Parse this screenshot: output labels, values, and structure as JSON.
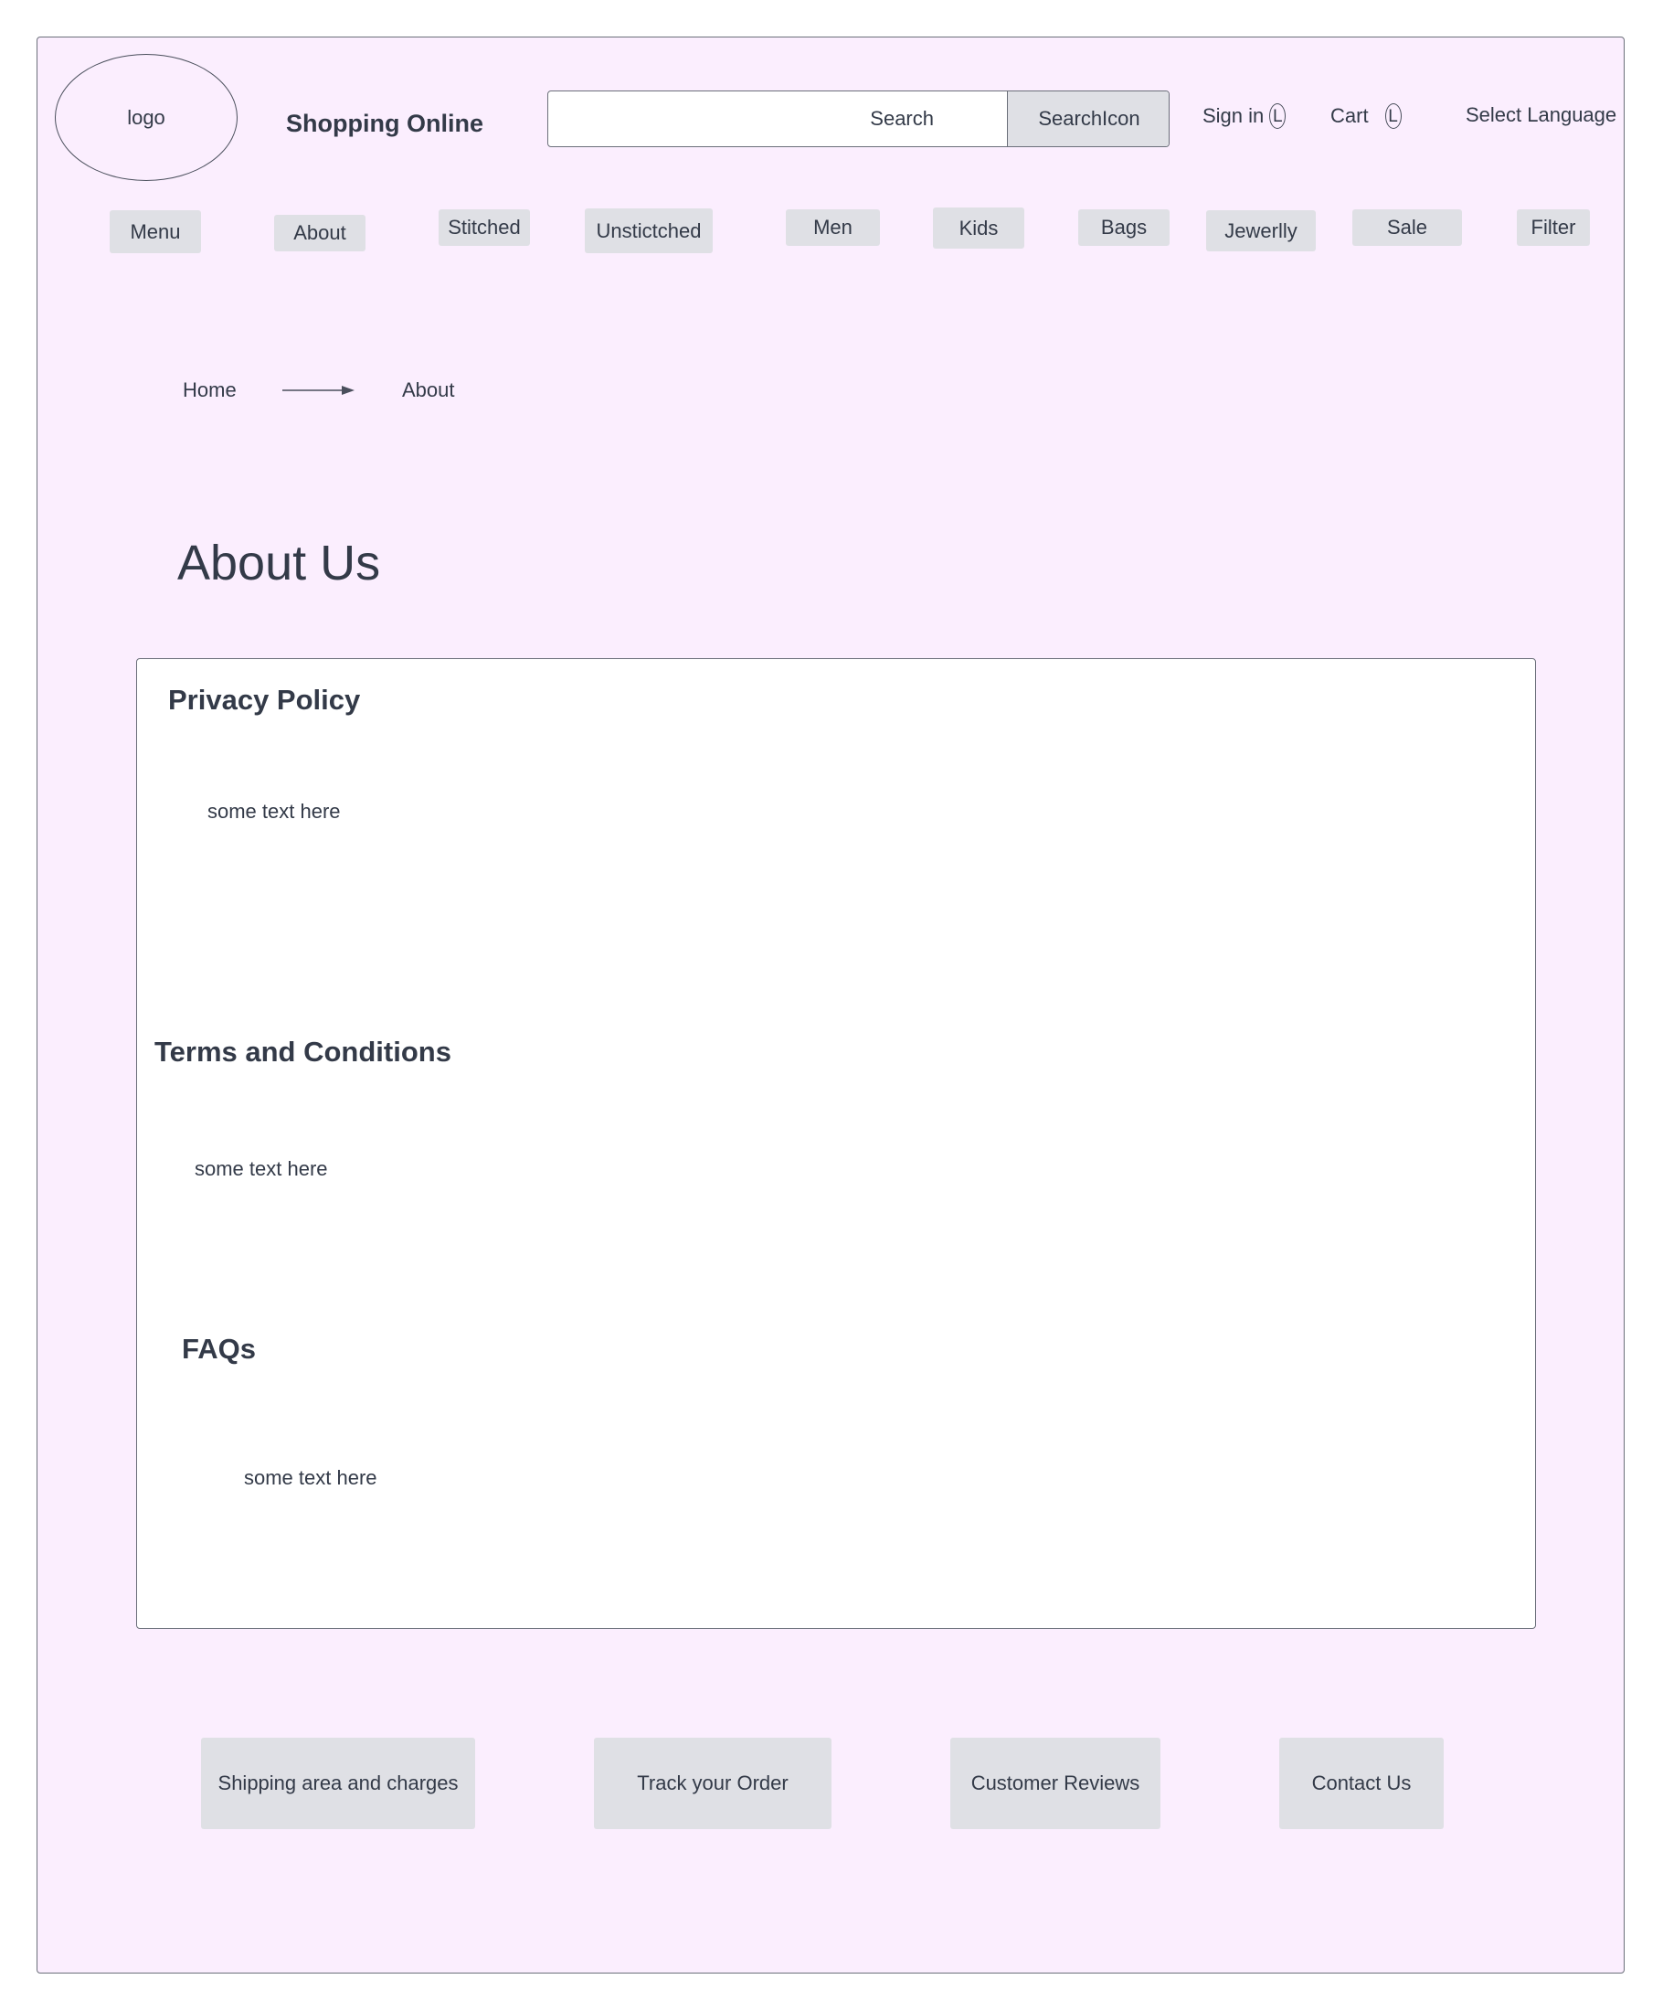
{
  "header": {
    "logo_text": "logo",
    "site_title": "Shopping Online",
    "search": {
      "placeholder": "Search",
      "button_label": "SearchIcon"
    },
    "sign_in": {
      "label": "Sign in",
      "icon": "L"
    },
    "cart": {
      "label": "Cart",
      "icon": "L"
    },
    "language": "Select Language"
  },
  "nav": {
    "items": [
      {
        "label": "Menu"
      },
      {
        "label": "About"
      },
      {
        "label": "Stitched"
      },
      {
        "label": "Unstictched"
      },
      {
        "label": "Men"
      },
      {
        "label": "Kids"
      },
      {
        "label": "Bags"
      },
      {
        "label": "Jewerlly"
      },
      {
        "label": "Sale"
      },
      {
        "label": "Filter"
      }
    ]
  },
  "breadcrumb": {
    "home": "Home",
    "current": "About"
  },
  "page_title": "About Us",
  "sections": [
    {
      "title": "Privacy Policy",
      "text": "some text here"
    },
    {
      "title": "Terms and Conditions",
      "text": "some text here"
    },
    {
      "title": "FAQs",
      "text": "some text here"
    }
  ],
  "footer": {
    "buttons": [
      {
        "label": "Shipping area and charges"
      },
      {
        "label": "Track your Order"
      },
      {
        "label": "Customer Reviews"
      },
      {
        "label": "Contact Us"
      }
    ]
  },
  "colors": {
    "page_background": "#fbeefe",
    "button_background": "#dfe0e5",
    "text": "#333a48",
    "border": "#6b6f7a"
  }
}
